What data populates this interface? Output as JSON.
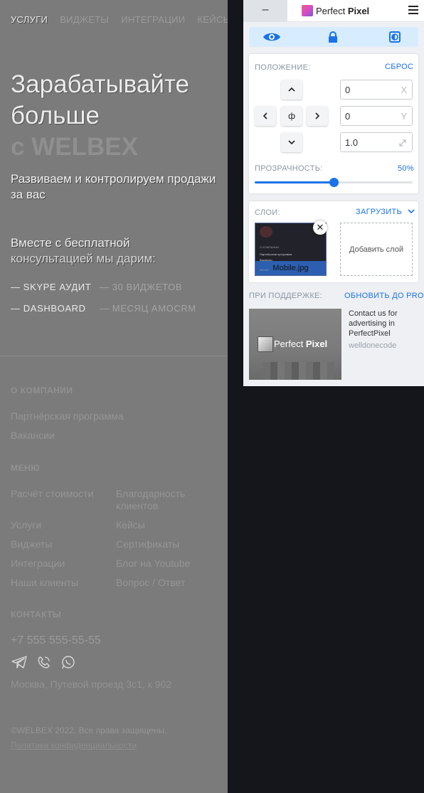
{
  "site": {
    "nav": [
      "УСЛУГИ",
      "ВИДЖЕТЫ",
      "ИНТЕГРАЦИИ",
      "КЕЙСЫ"
    ],
    "hero": {
      "line1": "Зарабатывайте",
      "line2": "больше",
      "line3": "с WELBEX"
    },
    "subtitle": "Развиваем и контролируем продажи за вас",
    "gift": {
      "line1": "Вместе с бесплатной",
      "line2": "консультацией мы дарим:"
    },
    "perks": [
      "— SKYPE АУДИТ",
      "— 30 ВИДЖЕТОВ",
      "— DASHBOARD",
      "— МЕСЯЦ AMOCRM"
    ],
    "footer": {
      "company_title": "О КОМПАНИИ",
      "company_links": [
        "Партнёрская программа",
        "Вакансии"
      ],
      "menu_title": "МЕНЮ",
      "menu_col1": [
        "Расчёт стоимости",
        "Услуги",
        "Виджеты",
        "Интеграции",
        "Наши клиенты"
      ],
      "menu_col2": [
        "Благодарность клиентов",
        "Кейсы",
        "Сертификаты",
        "Блог на Youtube",
        "Вопрос / Ответ"
      ],
      "contacts_title": "КОНТАКТЫ",
      "phone": "+7 555 555-55-55",
      "social_icons": [
        "telegram-icon",
        "viber-icon",
        "whatsapp-icon"
      ],
      "address": "Москва, Путевой проезд 3с1, к 902",
      "copyright": "©WELBEX 2022. Все права защищены.",
      "policy": "Политика конфиденциальности"
    }
  },
  "panel": {
    "minimize_label": "–",
    "brand": {
      "name_part1": "Perfect",
      "name_part2": "Pixel"
    },
    "toolbar_icons": [
      "eye-icon",
      "lock-icon",
      "invert-icon"
    ],
    "position_label": "ПОЛОЖЕНИЕ:",
    "reset_label": "СБРОС",
    "center_glyph": "ф",
    "x_value": "0",
    "x_unit": "X",
    "y_value": "0",
    "y_unit": "Y",
    "scale_value": "1.0",
    "opacity_label": "ПРОЗРАЧНОСТЬ:",
    "opacity_value": "50%",
    "opacity_fraction": 0.5,
    "layers_label": "СЛОИ:",
    "upload_label": "ЗАГРУЗИТЬ",
    "layer": {
      "name": "Mobile.jpg",
      "thumb_heading": "О КОМПАНИИ",
      "thumb_line1": "Партнёрская программа",
      "thumb_line2": "Вакансии",
      "thumb_line3": "МЕНЮ"
    },
    "add_layer_label": "Добавить слой",
    "support_label": "ПРИ ПОДДЕРЖКЕ:",
    "upgrade_label": "ОБНОВИТЬ ДО PRO",
    "ad": {
      "logo_text1": "Perfect",
      "logo_text2": "Pixel",
      "text": "Contact us for advertising in PerfectPixel",
      "source": "welldonecode"
    },
    "colors": {
      "accent": "#1a73e8",
      "toolbar_bg": "#d8ecff"
    }
  }
}
